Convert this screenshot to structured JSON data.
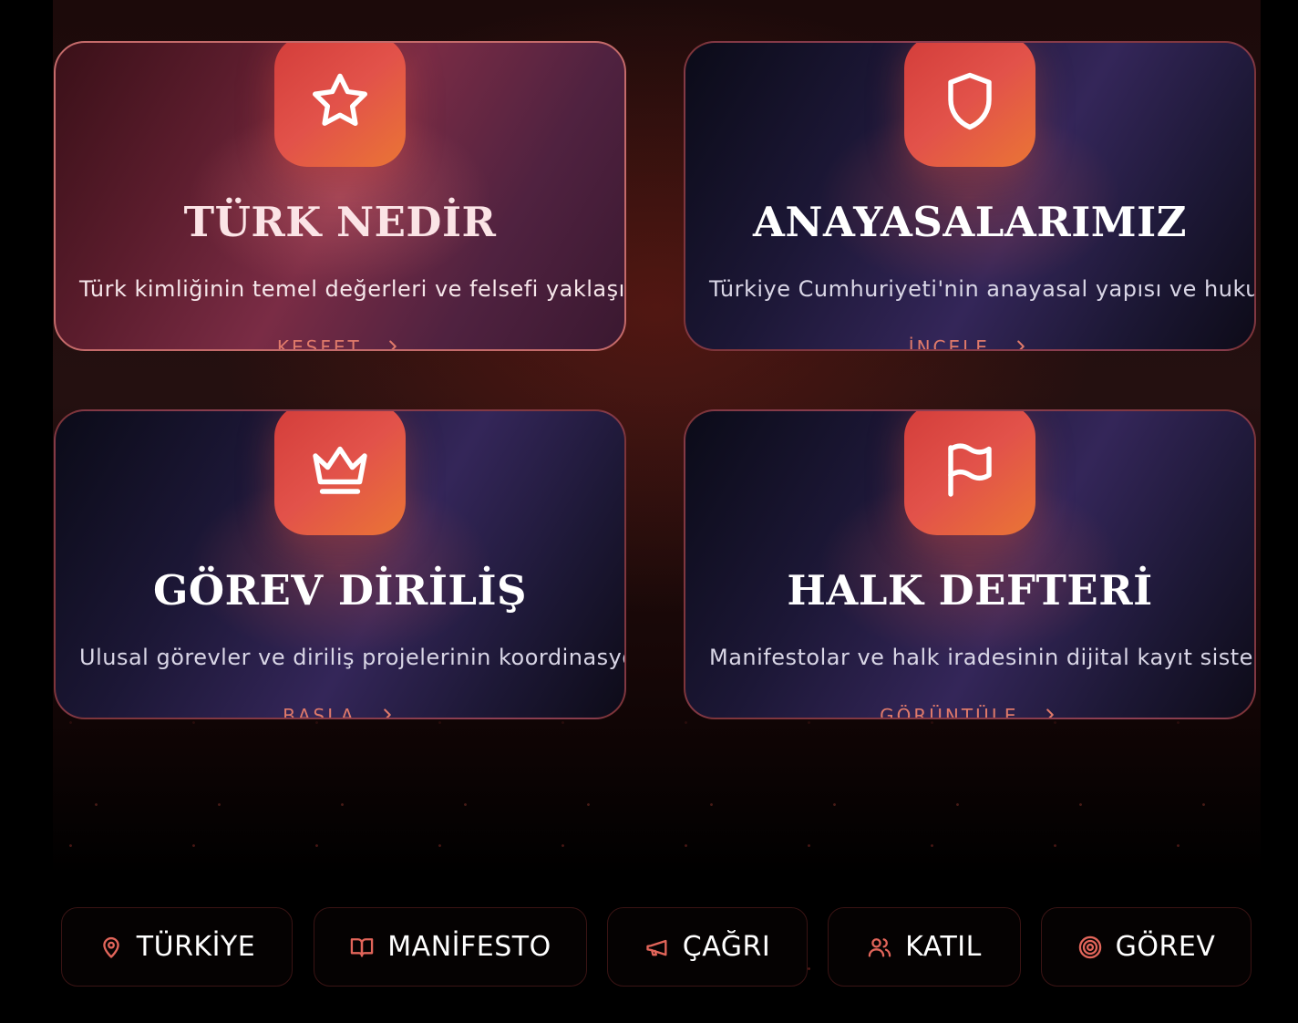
{
  "cards": [
    {
      "title": "TÜRK NEDİR",
      "description": "Türk kimliğinin temel değerleri ve felsefi yaklaşımı",
      "link": "KEŞFET",
      "icon": "star-icon"
    },
    {
      "title": "ANAYASALARIMIZ",
      "description": "Türkiye Cumhuriyeti'nin anayasal yapısı ve hukuku",
      "link": "İNCELE",
      "icon": "shield-icon"
    },
    {
      "title": "GÖREV DİRİLİŞ",
      "description": "Ulusal görevler ve diriliş projelerinin koordinasyonu",
      "link": "BAŞLA",
      "icon": "crown-icon"
    },
    {
      "title": "HALK DEFTERİ",
      "description": "Manifestolar ve halk iradesinin dijital kayıt sistemi",
      "link": "GÖRÜNTÜLE",
      "icon": "flag-icon"
    }
  ],
  "nav": [
    {
      "label": "TÜRKİYE",
      "icon": "map-pin-icon"
    },
    {
      "label": "MANİFESTO",
      "icon": "book-open-icon"
    },
    {
      "label": "ÇAĞRI",
      "icon": "megaphone-icon"
    },
    {
      "label": "KATIL",
      "icon": "users-icon"
    },
    {
      "label": "GÖREV",
      "icon": "target-icon"
    }
  ],
  "colors": {
    "accent": "#e2524a",
    "accent_orange": "#ea7535",
    "link": "#e07a6a",
    "background": "#000000"
  }
}
